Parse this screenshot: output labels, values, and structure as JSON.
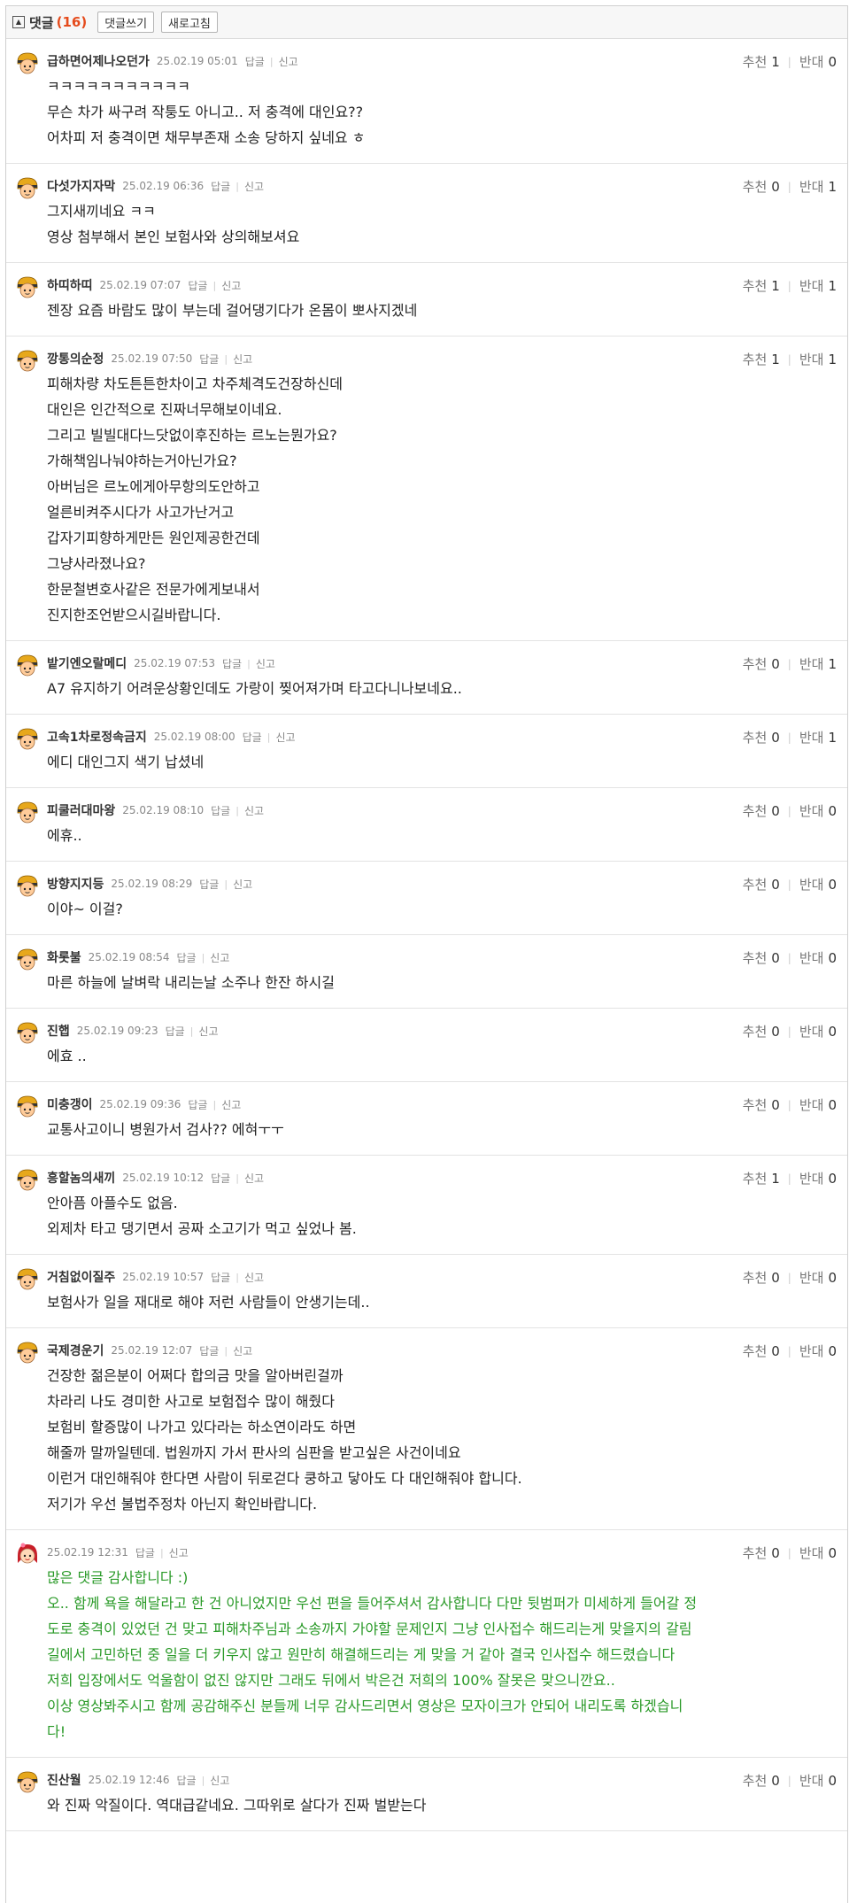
{
  "header": {
    "title": "댓글",
    "count": "(16)",
    "write_button": "댓글쓰기",
    "refresh_button": "새로고침"
  },
  "labels": {
    "reply": "답글",
    "report": "신고",
    "recommend": "추천",
    "oppose": "반대"
  },
  "colors": {
    "count": "#e54b1c",
    "author_reply": "#2a9a28"
  },
  "comments": [
    {
      "nick": "급하면어제나오던가",
      "date": "25.02.19 05:01",
      "up": "1",
      "down": "0",
      "lines": [
        "ㅋㅋㅋㅋㅋㅋㅋㅋㅋㅋㅋ",
        "무슨 차가 싸구려 작퉁도 아니고.. 저 충격에 대인요??",
        "어차피 저 충격이면 채무부존재 소송 당하지 싶네요 ㅎ"
      ]
    },
    {
      "nick": "다섯가지자막",
      "date": "25.02.19 06:36",
      "up": "0",
      "down": "1",
      "lines": [
        "그지새끼네요 ㅋㅋ",
        "영상 첨부해서 본인 보험사와 상의해보셔요"
      ]
    },
    {
      "nick": "하띠하띠",
      "date": "25.02.19 07:07",
      "up": "1",
      "down": "1",
      "lines": [
        "젠장 요즘 바람도 많이 부는데 걸어댕기다가 온몸이 뽀사지겠네"
      ]
    },
    {
      "nick": "깡통의순정",
      "date": "25.02.19 07:50",
      "up": "1",
      "down": "1",
      "lines": [
        "피해차량 차도튼튼한차이고 차주체격도건장하신데",
        "대인은 인간적으로 진짜너무해보이네요.",
        "그리고 빌빌대다느닷없이후진하는 르노는뭔가요?",
        "가해책임나눠야하는거아닌가요?",
        "아버님은 르노에게아무항의도안하고",
        "얼른비켜주시다가 사고가난거고",
        "갑자기피향하게만든 원인제공한건데",
        "그냥사라졌나요?",
        "한문철변호사같은 전문가에게보내서",
        "진지한조언받으시길바랍니다."
      ]
    },
    {
      "nick": "밭기엔오랄메디",
      "date": "25.02.19 07:53",
      "up": "0",
      "down": "1",
      "lines": [
        "A7 유지하기 어려운상황인데도 가랑이 찢어져가며 타고다니나보네요.."
      ]
    },
    {
      "nick": "고속1차로정속금지",
      "date": "25.02.19 08:00",
      "up": "0",
      "down": "1",
      "lines": [
        "에디 대인그지 색기 납셨네"
      ]
    },
    {
      "nick": "피쿨러대마왕",
      "date": "25.02.19 08:10",
      "up": "0",
      "down": "0",
      "lines": [
        "에휴.."
      ]
    },
    {
      "nick": "방향지지등",
      "date": "25.02.19 08:29",
      "up": "0",
      "down": "0",
      "lines": [
        "이야~ 이걸?"
      ]
    },
    {
      "nick": "화롯불",
      "date": "25.02.19 08:54",
      "up": "0",
      "down": "0",
      "lines": [
        "마른 하늘에 날벼락 내리는날 소주나 한잔 하시길"
      ]
    },
    {
      "nick": "진햅",
      "date": "25.02.19 09:23",
      "up": "0",
      "down": "0",
      "lines": [
        "에효 .."
      ]
    },
    {
      "nick": "미충갱이",
      "date": "25.02.19 09:36",
      "up": "0",
      "down": "0",
      "lines": [
        "교통사고이니 병원가서 검사?? 에혀ㅜㅜ"
      ]
    },
    {
      "nick": "흥할놈의새끼",
      "date": "25.02.19 10:12",
      "up": "1",
      "down": "0",
      "lines": [
        "안아픔 아플수도 없음.",
        "외제차 타고 댕기면서 공짜 소고기가 먹고 싶었나 봄."
      ]
    },
    {
      "nick": "거침없이질주",
      "date": "25.02.19 10:57",
      "up": "0",
      "down": "0",
      "lines": [
        "보험사가 일을 재대로 해야 저런 사람들이 안생기는데.."
      ]
    },
    {
      "nick": "국제경운기",
      "date": "25.02.19 12:07",
      "up": "0",
      "down": "0",
      "lines": [
        "건장한 젊은분이 어쩌다 합의금 맛을 알아버린걸까",
        "차라리 나도 경미한 사고로 보험접수 많이 해줬다",
        "보험비 할증많이 나가고 있다라는 하소연이라도 하면",
        "해줄까 말까일텐데. 법원까지 가서 판사의 심판을 받고싶은 사건이네요",
        "이런거 대인해줘야 한다면 사람이 뒤로걷다 쿵하고 닿아도 다 대인해줘야 합니다.",
        "저기가 우선 불법주정차 아닌지 확인바랍니다."
      ]
    },
    {
      "nick": "",
      "date": "25.02.19 12:31",
      "up": "0",
      "down": "0",
      "author": true,
      "lines": [
        "많은 댓글 감사합니다 :)",
        "오.. 함께 욕을 해달라고 한 건 아니었지만 우선 편을 들어주셔서 감사합니다 다만 뒷범퍼가 미세하게 들어갈 정",
        "도로 충격이 있었던 건 맞고 피해차주님과 소송까지 가야할 문제인지 그냥 인사접수 해드리는게 맞을지의 갈림",
        "길에서 고민하던 중 일을 더 키우지 않고 원만히 해결해드리는 게 맞을 거 같아 결국 인사접수 해드렸습니다",
        "저희 입장에서도 억울함이 없진 않지만 그래도 뒤에서 박은건 저희의 100% 잘못은 맞으니깐요..",
        "이상 영상봐주시고 함께 공감해주신 분들께 너무 감사드리면서 영상은 모자이크가 안되어 내리도록 하겠습니",
        "다!"
      ]
    },
    {
      "nick": "진산월",
      "date": "25.02.19 12:46",
      "up": "0",
      "down": "0",
      "lines": [
        "와 진짜 악질이다. 역대급같네요. 그따위로 살다가 진짜 벌받는다"
      ]
    }
  ]
}
